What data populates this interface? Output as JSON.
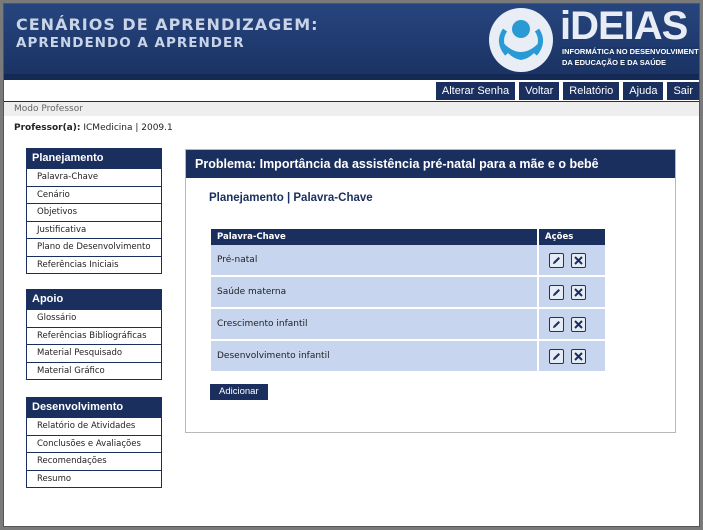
{
  "header": {
    "title_line1": "CENÁRIOS DE APRENDIZAGEM:",
    "title_line2": "APRENDENDO A APRENDER",
    "logo_name": "iDEIAS",
    "logo_sub1": "INFORMÁTICA NO DESENVOLVIMENTO",
    "logo_sub2": "DA EDUCAÇÃO E DA SAÚDE",
    "accent_color": "#1b2f5e"
  },
  "toolbar": {
    "buttons": [
      "Alterar Senha",
      "Voltar",
      "Relatório",
      "Ajuda",
      "Sair"
    ]
  },
  "mode": {
    "label": "Modo Professor"
  },
  "professor": {
    "label": "Professor(a):",
    "value": "ICMedicina | 2009.1"
  },
  "sidebar": {
    "sections": [
      {
        "title": "Planejamento",
        "items": [
          "Palavra-Chave",
          "Cenário",
          "Objetivos",
          "Justificativa",
          "Plano de Desenvolvimento",
          "Referências Iniciais"
        ]
      },
      {
        "title": "Apoio",
        "items": [
          "Glossário",
          "Referências Bibliográficas",
          "Material Pesquisado",
          "Material Gráfico"
        ]
      },
      {
        "title": "Desenvolvimento",
        "items": [
          "Relatório de Atividades",
          "Conclusões e Avaliações",
          "Recomendações",
          "Resumo"
        ]
      }
    ]
  },
  "main": {
    "problem_title": "Problema: Importância da assistência pré-natal para a mãe e o bebê",
    "breadcrumb": "Planejamento | Palavra-Chave",
    "table": {
      "headers": [
        "Palavra-Chave",
        "Ações"
      ],
      "rows": [
        "Pré-natal",
        "Saúde materna",
        "Crescimento infantil",
        "Desenvolvimento infantil"
      ],
      "row_color": "#c7d5ef"
    },
    "add_label": "Adicionar"
  }
}
